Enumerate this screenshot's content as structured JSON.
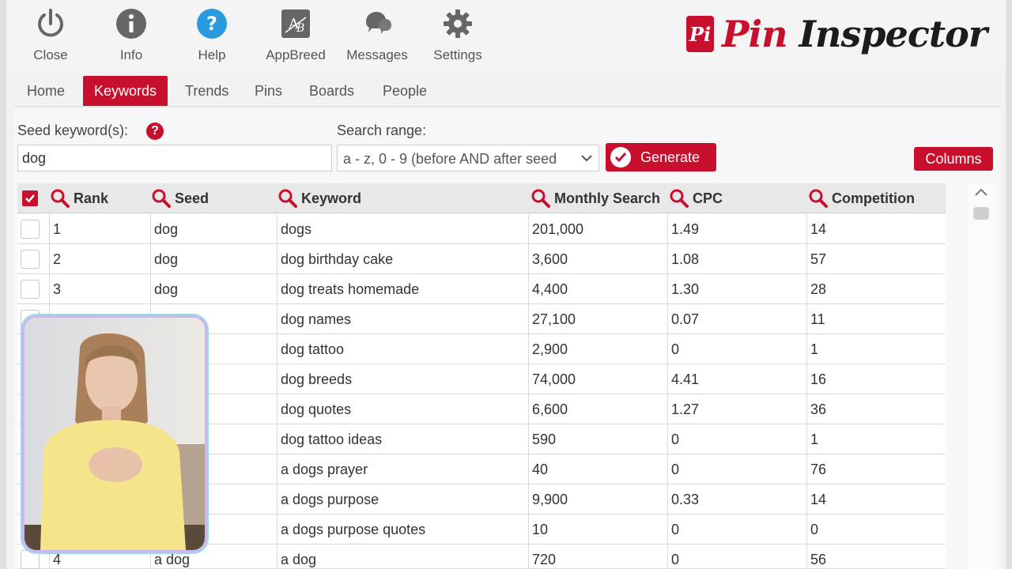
{
  "toolbar": {
    "items": [
      {
        "label": "Close",
        "icon": "power-icon"
      },
      {
        "label": "Info",
        "icon": "info-icon"
      },
      {
        "label": "Help",
        "icon": "help-icon"
      },
      {
        "label": "AppBreed",
        "icon": "appbreed-icon"
      },
      {
        "label": "Messages",
        "icon": "messages-icon"
      },
      {
        "label": "Settings",
        "icon": "gear-icon"
      }
    ]
  },
  "logo": {
    "badge": "Pi",
    "word1": "Pin",
    "word2": "Inspector"
  },
  "nav": {
    "tabs": [
      "Home",
      "Keywords",
      "Trends",
      "Pins",
      "Boards",
      "People"
    ],
    "active": "Keywords"
  },
  "form": {
    "seed_label": "Seed keyword(s):",
    "seed_help": "?",
    "seed_value": "dog",
    "range_label": "Search range:",
    "range_value": "a - z, 0 - 9 (before AND after seed",
    "generate_label": "Generate",
    "columns_label": "Columns"
  },
  "table": {
    "headers": {
      "rank": "Rank",
      "seed": "Seed",
      "keyword": "Keyword",
      "monthly": "Monthly Search",
      "cpc": "CPC",
      "competition": "Competition"
    },
    "rows": [
      {
        "rank": "1",
        "seed": "dog",
        "keyword": "dogs",
        "monthly": "201,000",
        "cpc": "1.49",
        "competition": "14"
      },
      {
        "rank": "2",
        "seed": "dog",
        "keyword": "dog birthday cake",
        "monthly": "3,600",
        "cpc": "1.08",
        "competition": "57"
      },
      {
        "rank": "3",
        "seed": "dog",
        "keyword": "dog treats homemade",
        "monthly": "4,400",
        "cpc": "1.30",
        "competition": "28"
      },
      {
        "rank": "",
        "seed": "",
        "keyword": "dog names",
        "monthly": "27,100",
        "cpc": "0.07",
        "competition": "11"
      },
      {
        "rank": "",
        "seed": "",
        "keyword": "dog tattoo",
        "monthly": "2,900",
        "cpc": "0",
        "competition": "1"
      },
      {
        "rank": "",
        "seed": "",
        "keyword": "dog breeds",
        "monthly": "74,000",
        "cpc": "4.41",
        "competition": "16"
      },
      {
        "rank": "",
        "seed": "",
        "keyword": "dog quotes",
        "monthly": "6,600",
        "cpc": "1.27",
        "competition": "36"
      },
      {
        "rank": "",
        "seed": "",
        "keyword": "dog tattoo ideas",
        "monthly": "590",
        "cpc": "0",
        "competition": "1"
      },
      {
        "rank": "",
        "seed": "",
        "keyword": "a dogs prayer",
        "monthly": "40",
        "cpc": "0",
        "competition": "76"
      },
      {
        "rank": "",
        "seed": "",
        "keyword": "a dogs purpose",
        "monthly": "9,900",
        "cpc": "0.33",
        "competition": "14"
      },
      {
        "rank": "",
        "seed": "",
        "keyword": "a dogs purpose quotes",
        "monthly": "10",
        "cpc": "0",
        "competition": "0"
      },
      {
        "rank": "4",
        "seed": "a dog",
        "keyword": "a dog",
        "monthly": "720",
        "cpc": "0",
        "competition": "56"
      }
    ]
  },
  "colors": {
    "accent": "#c8102e",
    "help_blue": "#2b9be0",
    "icon_gray": "#666666"
  }
}
